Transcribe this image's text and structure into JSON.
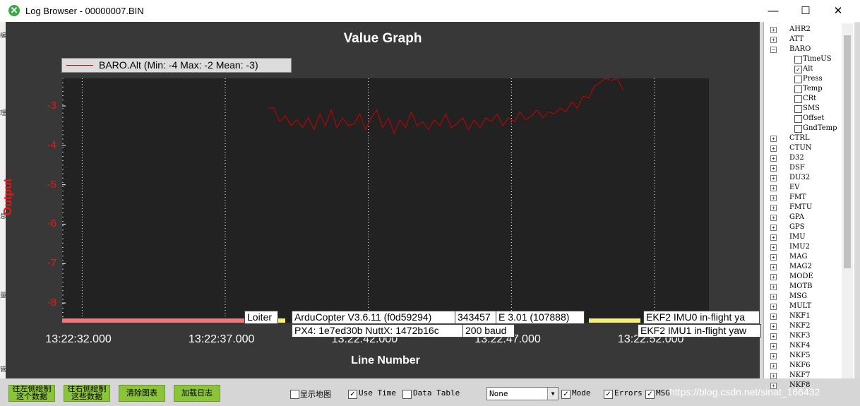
{
  "window": {
    "title": "Log Browser - 00000007.BIN",
    "icon": "mission-planner-icon",
    "minimize_glyph": "—",
    "maximize_glyph": "☐",
    "close_glyph": "✕"
  },
  "left_edge_glyphs": [
    "编",
    "理",
    "息",
    "量",
    "管"
  ],
  "chart_data": {
    "type": "line",
    "title": "Value Graph",
    "xlabel": "Line Number",
    "ylabel": "Output",
    "legend": "BARO.Alt (Min: -4 Max: -2 Mean: -3)",
    "legend_position": "top-left",
    "grid": true,
    "series_color": "#cc0000",
    "yticks": [
      "-3",
      "-4",
      "-5",
      "-6",
      "-7",
      "-8"
    ],
    "ylim": [
      -8.5,
      -2.3
    ],
    "xticks": [
      "13:22:32.000",
      "13:22:37.000",
      "13:22:42.000",
      "13:22:47.000",
      "13:22:52.000"
    ],
    "xlim": [
      0,
      22.6
    ],
    "series": [
      {
        "x": [
          7.2,
          7.4,
          7.6,
          7.8,
          8.0,
          8.2,
          8.4,
          8.6,
          8.8,
          9.0,
          9.2,
          9.4,
          9.6,
          9.8,
          10.0,
          10.2,
          10.4,
          10.6,
          10.8,
          11.0,
          11.2,
          11.4,
          11.6,
          11.8,
          12.0,
          12.2,
          12.4,
          12.6,
          12.8,
          13.0,
          13.2,
          13.4,
          13.6,
          13.8,
          14.0,
          14.2,
          14.4,
          14.6,
          14.8,
          15.0,
          15.2,
          15.4,
          15.6,
          15.8,
          16.0,
          16.2,
          16.4,
          16.6,
          16.8,
          17.0,
          17.2,
          17.4,
          17.6,
          17.8,
          18.0,
          18.2,
          18.4,
          18.6,
          18.8
        ],
        "y": [
          -3.05,
          -3.05,
          -3.4,
          -3.25,
          -3.5,
          -3.35,
          -3.55,
          -3.3,
          -3.6,
          -3.2,
          -3.5,
          -3.1,
          -3.55,
          -3.3,
          -3.5,
          -3.45,
          -3.2,
          -3.6,
          -3.3,
          -3.1,
          -3.55,
          -3.3,
          -3.7,
          -3.35,
          -3.55,
          -3.15,
          -3.5,
          -3.4,
          -3.6,
          -3.35,
          -3.5,
          -3.2,
          -3.55,
          -3.45,
          -3.3,
          -3.6,
          -3.35,
          -3.55,
          -3.3,
          -3.4,
          -3.2,
          -3.5,
          -3.3,
          -3.4,
          -3.15,
          -3.35,
          -3.25,
          -3.1,
          -3.3,
          -3.15,
          -3.2,
          -3.05,
          -3.15,
          -2.9,
          -3.05,
          -2.75,
          -2.8,
          -2.5,
          -2.4
        ]
      }
    ],
    "extra_trace": {
      "x": [
        18.8,
        19.0,
        19.2,
        19.4,
        19.6
      ],
      "y": [
        -2.4,
        -2.3,
        -2.35,
        -2.3,
        -2.6
      ]
    }
  },
  "mode_bands": [
    {
      "color": "#f07878",
      "from": 0,
      "to": 6.4
    },
    {
      "color": "#f5f07a",
      "from": 7.3,
      "to": 7.8
    },
    {
      "color": "#f5f07a",
      "from": 18.4,
      "to": 20.2
    }
  ],
  "annotations": {
    "loiter": "Loiter",
    "ardu": "ArduCopter V3.6.11 (f0d59294)",
    "px4": "PX4: 1e7ed30b NuttX: 1472b16c",
    "hex": "343457",
    "e301": "E 3.01 (107888)",
    "baud": "200 baud",
    "ekf0": "EKF2 IMU0 in-flight ya",
    "ekf1": "EKF2 IMU1 in-flight yaw"
  },
  "bottom": {
    "btn_left": "往左侧绘制这个数据",
    "btn_right": "往右侧绘制这些数据",
    "btn_clear": "清除图表",
    "btn_load": "加载日志",
    "show_map": "显示地图",
    "use_time": "Use Time",
    "data_table": "Data Table",
    "select_value": "None",
    "mode": "Mode",
    "errors": "Errors",
    "msg": "MSG",
    "watermark": "https://blog.csdn.net/sinat_166432"
  },
  "tree": {
    "groups_top": [
      "AHR2",
      "ATT"
    ],
    "baro": "BARO",
    "baro_fields": [
      {
        "label": "TimeUS",
        "checked": false
      },
      {
        "label": "Alt",
        "checked": true
      },
      {
        "label": "Press",
        "checked": false
      },
      {
        "label": "Temp",
        "checked": false
      },
      {
        "label": "CRt",
        "checked": false
      },
      {
        "label": "SMS",
        "checked": false
      },
      {
        "label": "Offset",
        "checked": false
      },
      {
        "label": "GndTemp",
        "checked": false
      }
    ],
    "groups_bottom": [
      "CTRL",
      "CTUN",
      "D32",
      "DSF",
      "DU32",
      "EV",
      "FMT",
      "FMTU",
      "GPA",
      "GPS",
      "IMU",
      "IMU2",
      "MAG",
      "MAG2",
      "MODE",
      "MOTB",
      "MSG",
      "MULT",
      "NKF1",
      "NKF2",
      "NKF3",
      "NKF4",
      "NKF5",
      "NKF6",
      "NKF7",
      "NKF8"
    ]
  }
}
